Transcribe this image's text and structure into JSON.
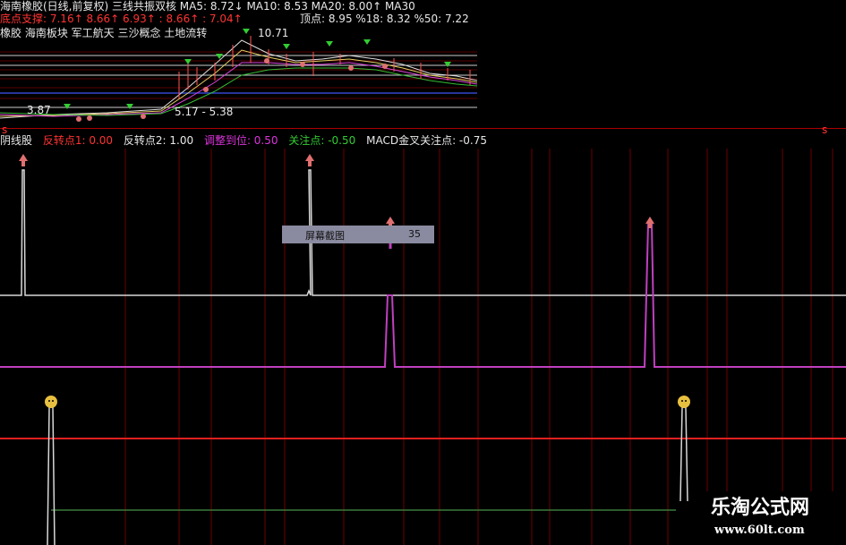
{
  "kline_header": {
    "title_line": "海南橡胶(日线,前复权)  三线共振双核  MA5: 8.72↓  MA10: 8.53  MA20: 8.00↑  MA30",
    "support_line": "底点支撑: 7.16↑  8.66↑  6.93↑  : 8.66↑  : 7.04↑",
    "top_point": "顶点: 8.95  %18: 8.32  %50: 7.22",
    "concepts": "橡胶  海南板块  军工航天  三沙概念  土地流转",
    "peak_price": "10.71",
    "low_left_price": "3.87",
    "range_label": "5.17 - 5.38",
    "side_label": "s"
  },
  "indicator_header": {
    "name": "阴线股",
    "reversal1": "反转点1: 0.00",
    "reversal2": "反转点2: 1.00",
    "adjust": "调整到位: 0.50",
    "focus": "关注点: -0.50",
    "macd": "MACD金叉关注点: -0.75"
  },
  "tooltip": {
    "label": "屏幕截图",
    "value": "35"
  },
  "watermark": {
    "site_name": "乐淘公式网",
    "site_url": "www.60lt.com"
  },
  "colors": {
    "background": "#000000",
    "grid": "#6b0000",
    "white_line": "#d8d8d8",
    "magenta": "#c040c0",
    "red_line": "#e02020",
    "green_line": "#3a7a3a",
    "gold_marker": "#e8c040",
    "header_red": "#ff3333",
    "header_green": "#33cc33",
    "header_magenta": "#dd33dd"
  }
}
